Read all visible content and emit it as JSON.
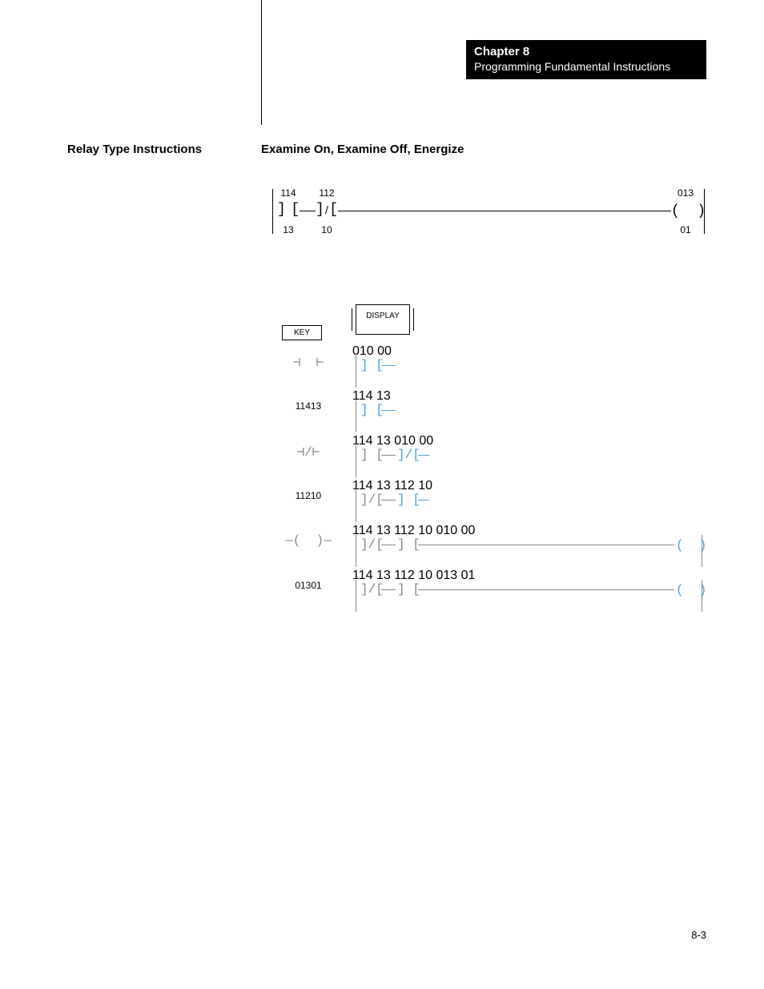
{
  "chapter": {
    "title": "Chapter 8",
    "subtitle": "Programming Fundamental Instructions"
  },
  "section_title": "Relay Type Instructions",
  "subsection_title": "Examine On, Examine Off, Energize",
  "page_number": "8-3",
  "main_rung": {
    "contact1": {
      "top": "114",
      "bottom": "13",
      "type": "XIC"
    },
    "contact2": {
      "top": "112",
      "bottom": "10",
      "type": "XIO"
    },
    "coil": {
      "top": "013",
      "bottom": "01"
    }
  },
  "headers": {
    "key": "KEY",
    "display": "DISPLAY"
  },
  "rows": [
    {
      "key_symbol": "XIC",
      "key_text": "",
      "display": [
        {
          "type": "XIC",
          "top": "010",
          "bottom": "00",
          "hl": true,
          "rail_left": true
        }
      ]
    },
    {
      "key_symbol": "",
      "key_text": "11413",
      "display": [
        {
          "type": "XIC",
          "top": "114",
          "bottom": "13",
          "hl": true,
          "rail_left": true
        }
      ]
    },
    {
      "key_symbol": "XIO",
      "key_text": "",
      "display": [
        {
          "type": "XIC",
          "top": "114",
          "bottom": "13",
          "rail_left": true
        },
        {
          "type": "XIO",
          "top": "010",
          "bottom": "00",
          "hl": true
        }
      ]
    },
    {
      "key_symbol": "",
      "key_text": "11210",
      "display": [
        {
          "type": "XIO",
          "top": "114",
          "bottom": "13",
          "rail_left": true
        },
        {
          "type": "XIC",
          "top": "112",
          "bottom": "10",
          "hl": true
        }
      ]
    },
    {
      "key_symbol": "OTE",
      "key_text": "",
      "display": [
        {
          "type": "XIO",
          "top": "114",
          "bottom": "13",
          "rail_left": true
        },
        {
          "type": "XIC",
          "top": "112",
          "bottom": "10"
        }
      ],
      "coil": {
        "top": "010",
        "bottom": "00",
        "hl": true
      }
    },
    {
      "key_symbol": "",
      "key_text": "01301",
      "display": [
        {
          "type": "XIO",
          "top": "114",
          "bottom": "13",
          "rail_left": true
        },
        {
          "type": "XIC",
          "top": "112",
          "bottom": "10"
        }
      ],
      "coil": {
        "top": "013",
        "bottom": "01",
        "hl": true
      }
    }
  ]
}
